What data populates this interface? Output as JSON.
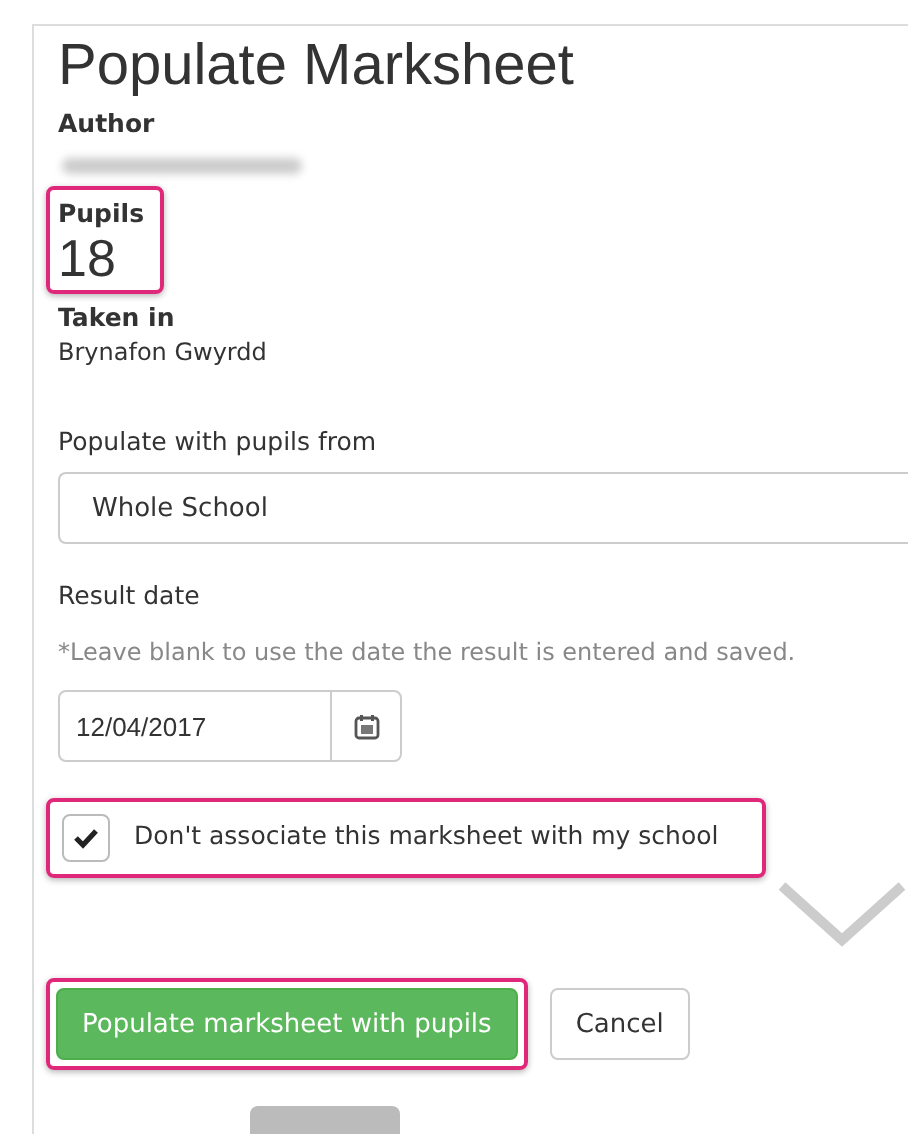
{
  "title": "Populate Marksheet",
  "author": {
    "label": "Author"
  },
  "pupils": {
    "label": "Pupils",
    "value": "18",
    "highlighted": true
  },
  "taken_in": {
    "label": "Taken in",
    "value": "Brynafon Gwyrdd"
  },
  "populate_from": {
    "label": "Populate with pupils from",
    "value": "Whole School"
  },
  "result_date": {
    "label": "Result date",
    "hint": "*Leave blank to use the date the result is entered and saved.",
    "value": "12/04/2017"
  },
  "dont_associate": {
    "label": "Don't associate this marksheet with my school",
    "checked": true,
    "highlighted": true
  },
  "buttons": [
    {
      "label": "Populate marksheet with pupils",
      "kind": "primary",
      "highlighted": true
    },
    {
      "label": "Cancel",
      "kind": "default",
      "highlighted": false
    }
  ]
}
